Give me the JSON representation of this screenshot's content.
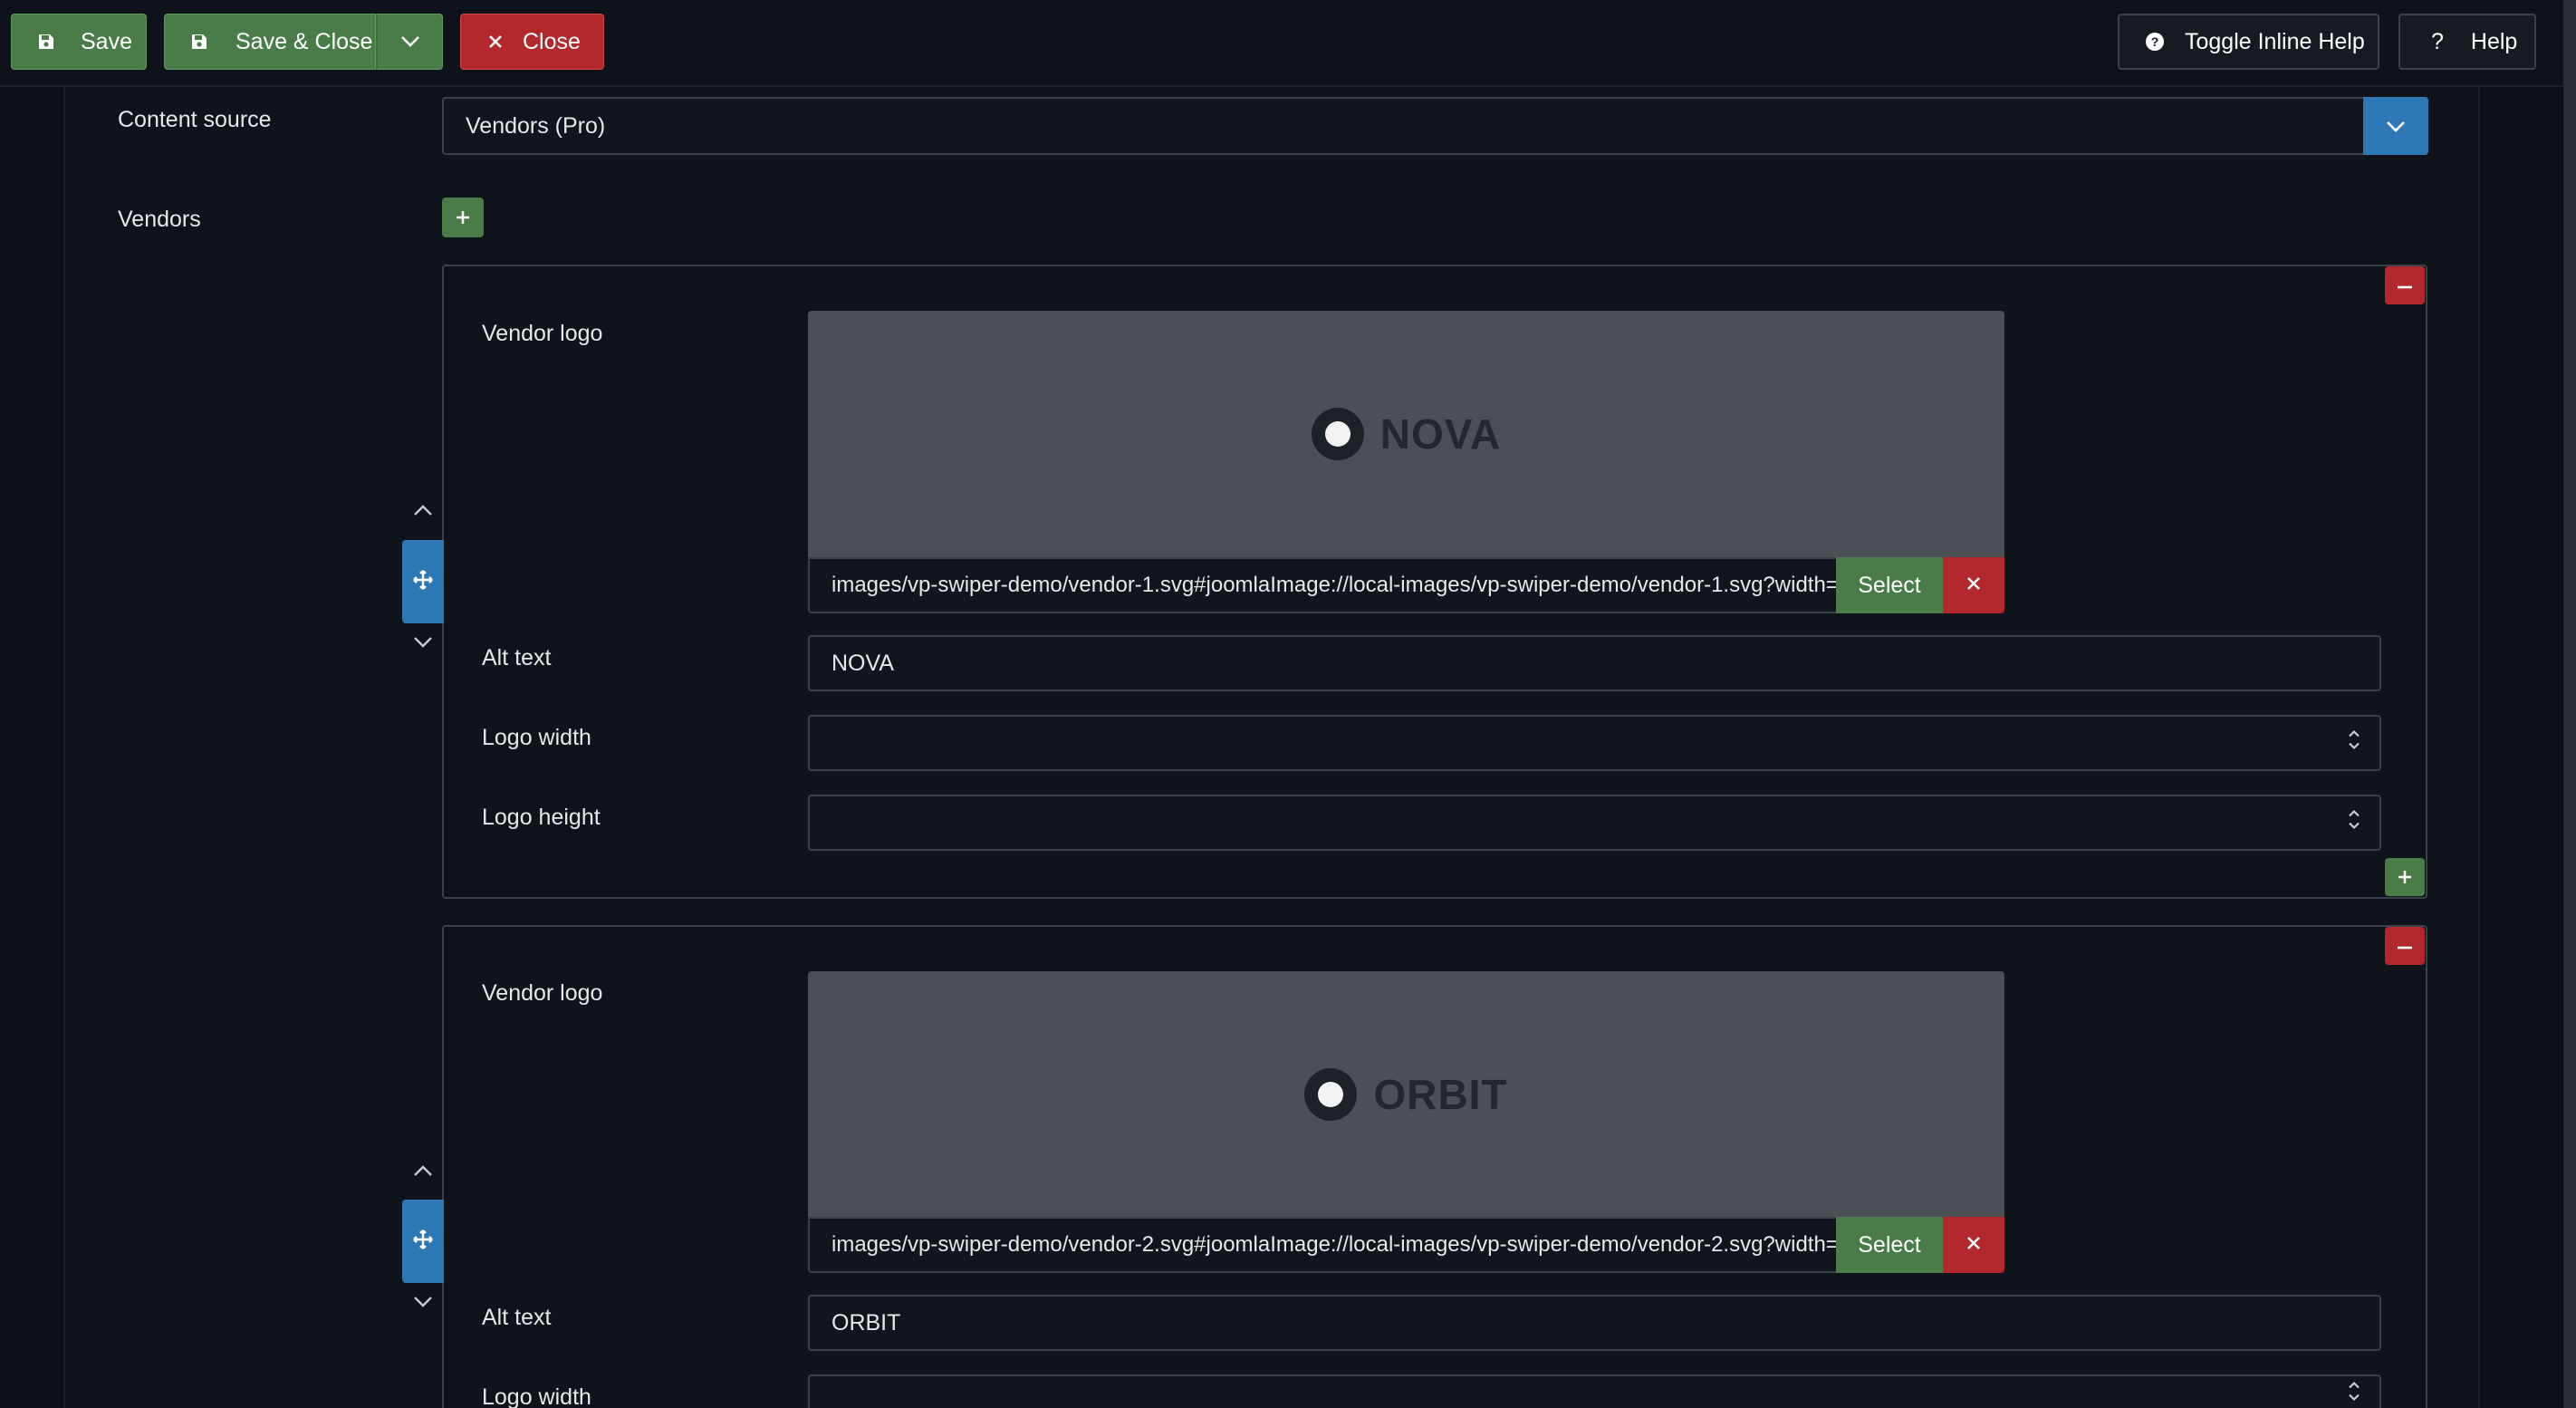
{
  "toolbar": {
    "save_label": "Save",
    "save_close_label": "Save & Close",
    "close_label": "Close",
    "toggle_help_label": "Toggle Inline Help",
    "help_label": "Help"
  },
  "form": {
    "content_source_label": "Content source",
    "content_source_value": "Vendors (Pro)",
    "vendors_label": "Vendors"
  },
  "vendors": [
    {
      "logo_label": "Vendor logo",
      "logo_text": "NOVA",
      "path": "images/vp-swiper-demo/vendor-1.svg#joomlaImage://local-images/vp-swiper-demo/vendor-1.svg?width=240&height=80",
      "select_label": "Select",
      "alt_label": "Alt text",
      "alt_value": "NOVA",
      "width_label": "Logo width",
      "height_label": "Logo height"
    },
    {
      "logo_label": "Vendor logo",
      "logo_text": "ORBIT",
      "path": "images/vp-swiper-demo/vendor-2.svg#joomlaImage://local-images/vp-swiper-demo/vendor-2.svg?width=240&height=80",
      "select_label": "Select",
      "alt_label": "Alt text",
      "alt_value": "ORBIT",
      "width_label": "Logo width"
    }
  ],
  "colors": {
    "success": "#4a7c4a",
    "danger": "#b3282d",
    "primary": "#2f78b6",
    "background": "#0f141b"
  },
  "icons": [
    "save-icon",
    "chevron-down-icon",
    "close-icon",
    "question-circle-icon",
    "question-icon",
    "plus-icon",
    "minus-icon",
    "move-icon",
    "chevron-up-icon",
    "spinner-icon"
  ]
}
